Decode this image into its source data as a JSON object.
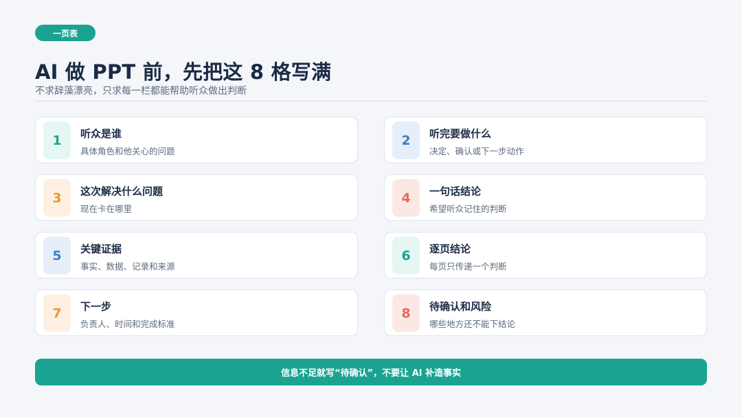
{
  "tag": "一页表",
  "title": "AI 做 PPT 前，先把这 8 格写满",
  "subtitle": "不求辞藻漂亮，只求每一栏都能帮助听众做出判断",
  "items": [
    {
      "num": "1",
      "title": "听众是谁",
      "desc": "具体角色和他关心的问题",
      "color": "#1aa391",
      "bg": "#e6f6f2"
    },
    {
      "num": "2",
      "title": "听完要做什么",
      "desc": "决定、确认或下一步动作",
      "color": "#3d7fc4",
      "bg": "#e6eefa"
    },
    {
      "num": "3",
      "title": "这次解决什么问题",
      "desc": "现在卡在哪里",
      "color": "#e8963a",
      "bg": "#fdf0e0"
    },
    {
      "num": "4",
      "title": "一句话结论",
      "desc": "希望听众记住的判断",
      "color": "#e06c5a",
      "bg": "#fbe8e4"
    },
    {
      "num": "5",
      "title": "关键证据",
      "desc": "事实、数据、记录和来源",
      "color": "#3d7fc4",
      "bg": "#e6eefa"
    },
    {
      "num": "6",
      "title": "逐页结论",
      "desc": "每页只传递一个判断",
      "color": "#1aa391",
      "bg": "#e6f6f2"
    },
    {
      "num": "7",
      "title": "下一步",
      "desc": "负责人、时间和完成标准",
      "color": "#e8963a",
      "bg": "#fdf0e0"
    },
    {
      "num": "8",
      "title": "待确认和风险",
      "desc": "哪些地方还不能下结论",
      "color": "#e06c5a",
      "bg": "#fbe8e4"
    }
  ],
  "footer": "信息不足就写“待确认”，不要让 AI 补造事实"
}
